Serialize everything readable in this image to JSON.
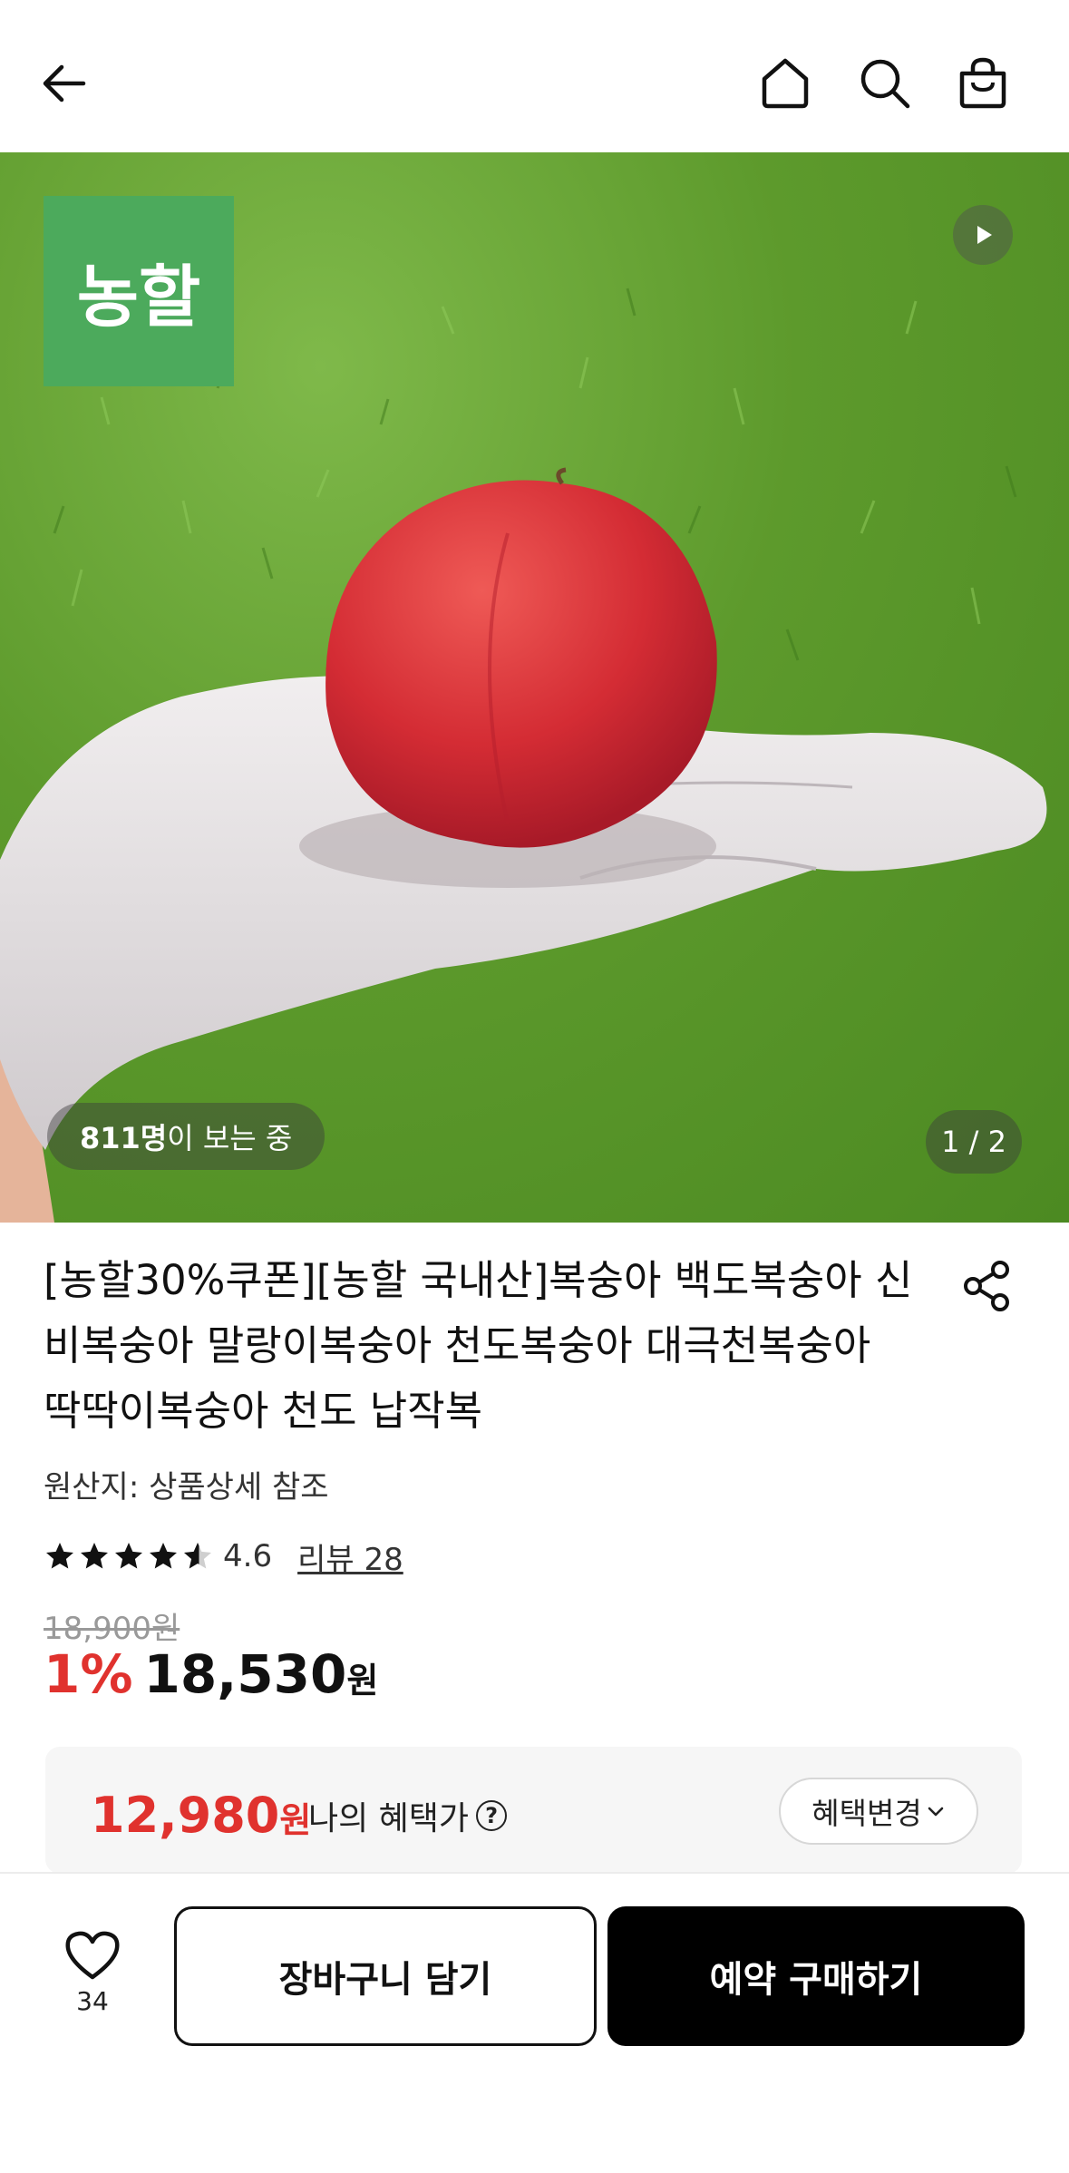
{
  "topbar": {
    "icons": [
      "back-arrow-icon",
      "home-icon",
      "search-icon",
      "shopping-bag-icon"
    ]
  },
  "hero": {
    "brand_logo_text": "농할",
    "viewers_count": "811명",
    "viewers_suffix": "이 보는 중",
    "pager": "1 / 2"
  },
  "product": {
    "title": "[농할30%쿠폰][농할 국내산]복숭아 백도복숭아 신비복숭아 말랑이복숭아 천도복숭아 대극천복숭아 딱딱이복숭아 천도 납작복",
    "origin": "원산지: 상품상세 참조",
    "rating": 4.6,
    "rating_text": "4.6",
    "reviews": "리뷰 28",
    "original_price": "18,900원",
    "discount": "1%",
    "price": "18,530",
    "price_unit": "원"
  },
  "benefit": {
    "price": "12,980",
    "unit": "원",
    "label": "나의 혜택가",
    "help": "?",
    "change_button": "혜택변경"
  },
  "bottom": {
    "like_count": "34",
    "cart_button": "장바구니 담기",
    "buy_button": "예약 구매하기"
  },
  "colors": {
    "accent_red": "#e0322e",
    "brand_green": "#4caa5c",
    "buy_black": "#000000"
  }
}
